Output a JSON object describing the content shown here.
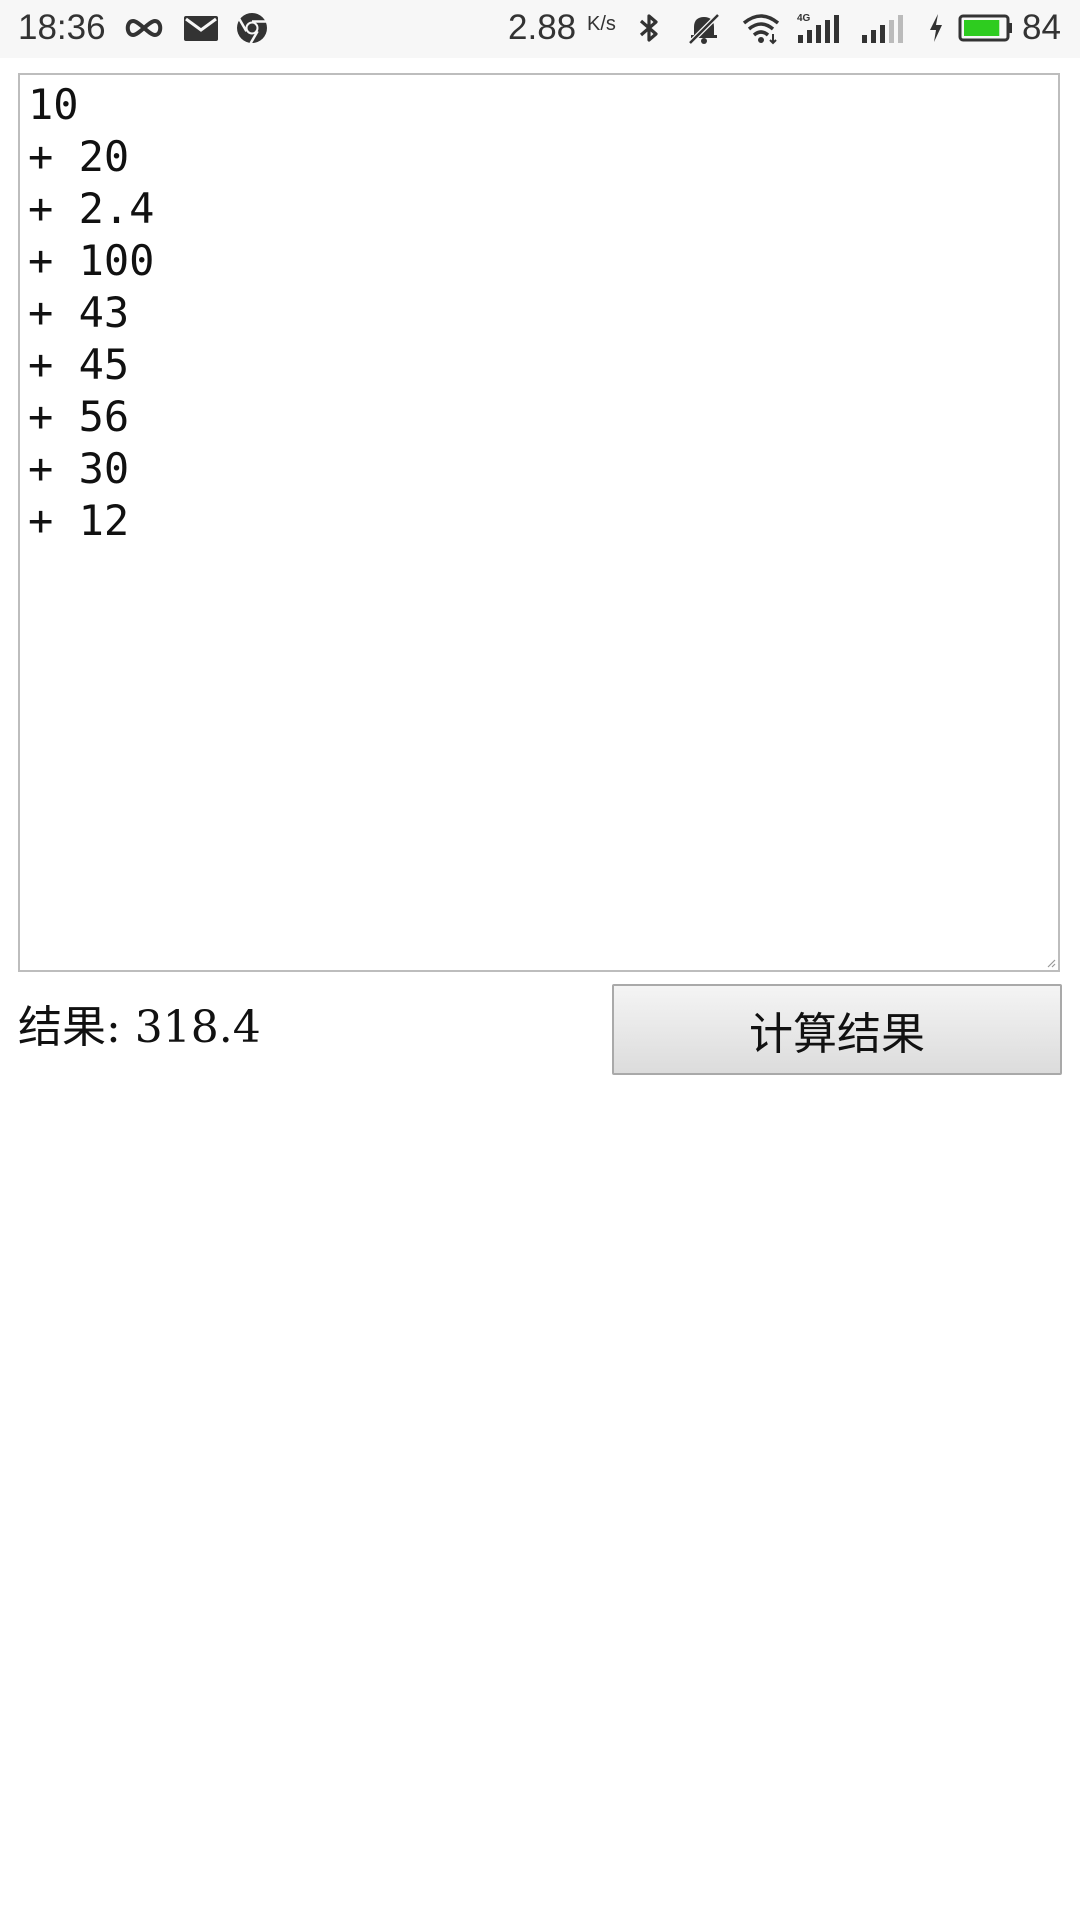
{
  "status_bar": {
    "time": "18:36",
    "net_speed": "2.88",
    "net_speed_unit": "K/s",
    "battery_level": "84",
    "battery_color": "#2ecc1f",
    "icons": [
      "infinity-icon",
      "mail-icon",
      "chrome-icon",
      "bluetooth-icon",
      "bell-muted-icon",
      "wifi-icon",
      "signal-4g-icon",
      "signal-icon",
      "charging-icon",
      "battery-icon"
    ]
  },
  "calculator": {
    "expression": "10\n+ 20\n+ 2.4\n+ 100\n+ 43\n+ 45\n+ 56\n+ 30\n+ 12",
    "result_label": "结果: 318.4",
    "calc_button_label": "计算结果"
  }
}
